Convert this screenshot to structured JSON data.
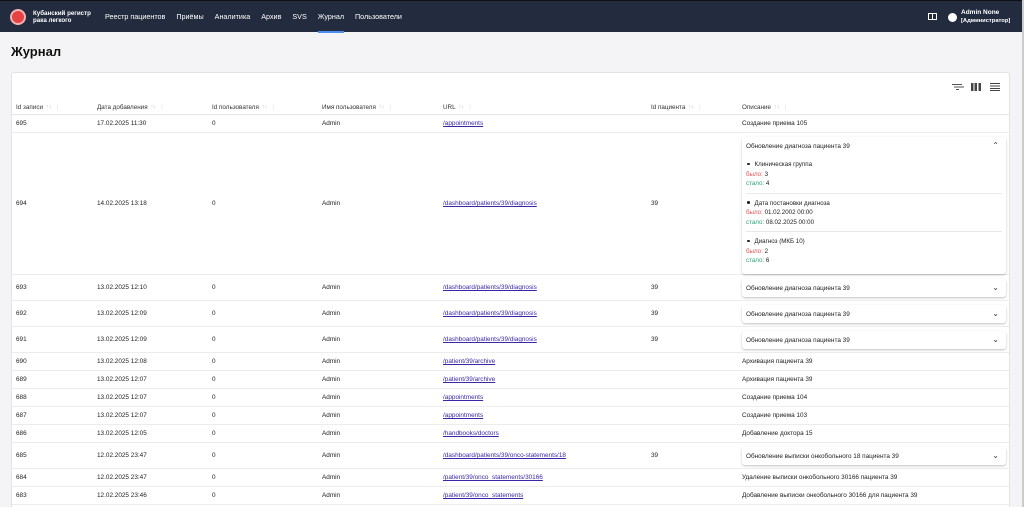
{
  "brand": {
    "line1": "Кубанский регистр",
    "line2": "рака легкого"
  },
  "nav": [
    "Реестр пациентов",
    "Приёмы",
    "Аналитика",
    "Архив",
    "SVS",
    "Журнал",
    "Пользователи"
  ],
  "nav_active": "Журнал",
  "user": {
    "name": "Admin None",
    "role": "[Администратор]"
  },
  "page_title": "Журнал",
  "columns": [
    "Id записи",
    "Дата добавления",
    "Id пользователя",
    "Имя пользователя",
    "URL",
    "Id пациента",
    "Описание"
  ],
  "change_labels": {
    "was": "было:",
    "now": "стало:"
  },
  "rows": [
    {
      "id": "695",
      "date": "17.02.2025 11:30",
      "user_id": "0",
      "user_name": "Admin",
      "url": "/appointments",
      "patient_id": "",
      "desc": "Создание приема 105"
    },
    {
      "id": "694",
      "date": "14.02.2025 13:18",
      "user_id": "0",
      "user_name": "Admin",
      "url": "/dashboard/patients/39/diagnosis",
      "patient_id": "39",
      "desc": "Обновление диагноза пациента 39",
      "changes": [
        {
          "field": "Клиническая группа",
          "was": "3",
          "now": "4"
        },
        {
          "field": "Дата постановки диагноза",
          "was": "01.02.2002 00:00",
          "now": "08.02.2025 00:00"
        },
        {
          "field": "Диагноз (МКБ 10)",
          "was": "2",
          "now": "6"
        }
      ]
    },
    {
      "id": "693",
      "date": "13.02.2025 12:10",
      "user_id": "0",
      "user_name": "Admin",
      "url": "/dashboard/patients/39/diagnosis",
      "patient_id": "39",
      "desc": "Обновление диагноза пациента 39"
    },
    {
      "id": "692",
      "date": "13.02.2025 12:09",
      "user_id": "0",
      "user_name": "Admin",
      "url": "/dashboard/patients/39/diagnosis",
      "patient_id": "39",
      "desc": "Обновление диагноза пациента 39"
    },
    {
      "id": "691",
      "date": "13.02.2025 12:09",
      "user_id": "0",
      "user_name": "Admin",
      "url": "/dashboard/patients/39/diagnosis",
      "patient_id": "39",
      "desc": "Обновление диагноза пациента 39"
    },
    {
      "id": "690",
      "date": "13.02.2025 12:08",
      "user_id": "0",
      "user_name": "Admin",
      "url": "/patient/39/archive",
      "patient_id": "",
      "desc": "Архивация пациента 39"
    },
    {
      "id": "689",
      "date": "13.02.2025 12:07",
      "user_id": "0",
      "user_name": "Admin",
      "url": "/patient/39/archive",
      "patient_id": "",
      "desc": "Архивация пациента 39"
    },
    {
      "id": "688",
      "date": "13.02.2025 12:07",
      "user_id": "0",
      "user_name": "Admin",
      "url": "/appointments",
      "patient_id": "",
      "desc": "Создание приема 104"
    },
    {
      "id": "687",
      "date": "13.02.2025 12:07",
      "user_id": "0",
      "user_name": "Admin",
      "url": "/appointments",
      "patient_id": "",
      "desc": "Создание приема 103"
    },
    {
      "id": "686",
      "date": "13.02.2025 12:05",
      "user_id": "0",
      "user_name": "Admin",
      "url": "/handbooks/doctors",
      "patient_id": "",
      "desc": "Добавление доктора 15"
    },
    {
      "id": "685",
      "date": "12.02.2025 23:47",
      "user_id": "0",
      "user_name": "Admin",
      "url": "/dashboard/patients/39/onco-statements/18",
      "patient_id": "39",
      "desc": "Обновление выписки онкобольного 18 пациента 39"
    },
    {
      "id": "684",
      "date": "12.02.2025 23:47",
      "user_id": "0",
      "user_name": "Admin",
      "url": "/patient/39/onco_statements/30166",
      "patient_id": "",
      "desc": "Удаление выписки онкобольного 30166 пациента 39"
    },
    {
      "id": "683",
      "date": "12.02.2025 23:46",
      "user_id": "0",
      "user_name": "Admin",
      "url": "/patient/39/onco_statements",
      "patient_id": "",
      "desc": "Добавление выписки онкобольного 30166 для пациента 39"
    }
  ]
}
